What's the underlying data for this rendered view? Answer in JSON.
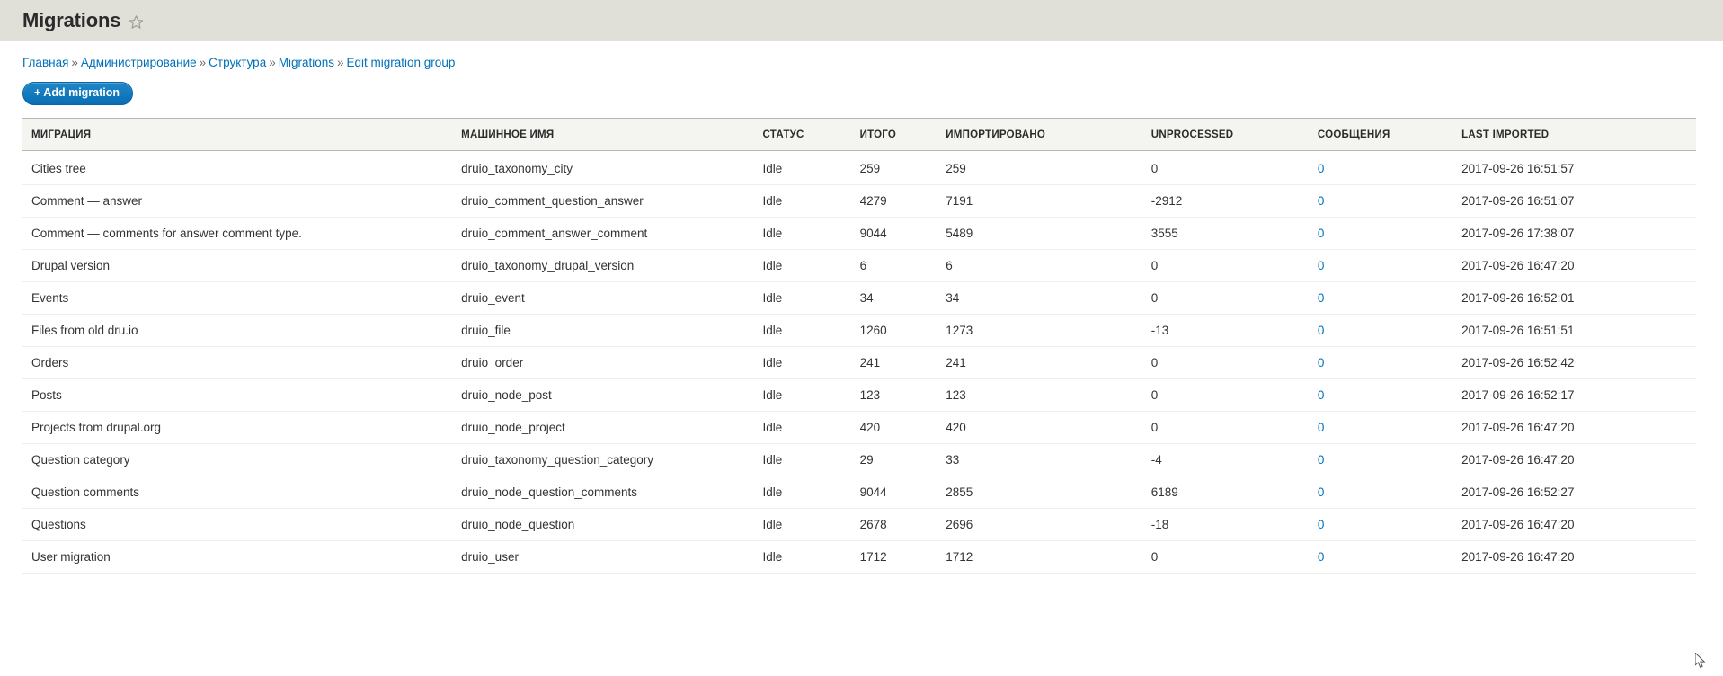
{
  "header": {
    "title": "Migrations",
    "star_icon": "star-outline-icon"
  },
  "breadcrumb": {
    "separator": "»",
    "items": [
      {
        "label": "Главная",
        "link": true
      },
      {
        "label": "Администрирование",
        "link": true
      },
      {
        "label": "Структура",
        "link": true
      },
      {
        "label": "Migrations",
        "link": true
      },
      {
        "label": "Edit migration group",
        "link": true
      }
    ]
  },
  "actions": {
    "add_migration_label": "+ Add migration"
  },
  "colors": {
    "header_band": "#e0e0d8",
    "link": "#0071b8",
    "button": "#1078be",
    "table_head_bg": "#f4f4f0",
    "row_border": "#eeeeea"
  },
  "table": {
    "columns": [
      "МИГРАЦИЯ",
      "МАШИННОЕ ИМЯ",
      "СТАТУС",
      "ИТОГО",
      "ИМПОРТИРОВАНО",
      "UNPROCESSED",
      "СООБЩЕНИЯ",
      "LAST IMPORTED"
    ],
    "rows": [
      {
        "name": "Cities tree",
        "machine_name": "druio_taxonomy_city",
        "status": "Idle",
        "total": "259",
        "imported": "259",
        "unprocessed": "0",
        "messages": "0",
        "last_imported": "2017-09-26 16:51:57"
      },
      {
        "name": "Comment — answer",
        "machine_name": "druio_comment_question_answer",
        "status": "Idle",
        "total": "4279",
        "imported": "7191",
        "unprocessed": "-2912",
        "messages": "0",
        "last_imported": "2017-09-26 16:51:07"
      },
      {
        "name": "Comment — comments for answer comment type.",
        "machine_name": "druio_comment_answer_comment",
        "status": "Idle",
        "total": "9044",
        "imported": "5489",
        "unprocessed": "3555",
        "messages": "0",
        "last_imported": "2017-09-26 17:38:07"
      },
      {
        "name": "Drupal version",
        "machine_name": "druio_taxonomy_drupal_version",
        "status": "Idle",
        "total": "6",
        "imported": "6",
        "unprocessed": "0",
        "messages": "0",
        "last_imported": "2017-09-26 16:47:20"
      },
      {
        "name": "Events",
        "machine_name": "druio_event",
        "status": "Idle",
        "total": "34",
        "imported": "34",
        "unprocessed": "0",
        "messages": "0",
        "last_imported": "2017-09-26 16:52:01"
      },
      {
        "name": "Files from old dru.io",
        "machine_name": "druio_file",
        "status": "Idle",
        "total": "1260",
        "imported": "1273",
        "unprocessed": "-13",
        "messages": "0",
        "last_imported": "2017-09-26 16:51:51"
      },
      {
        "name": "Orders",
        "machine_name": "druio_order",
        "status": "Idle",
        "total": "241",
        "imported": "241",
        "unprocessed": "0",
        "messages": "0",
        "last_imported": "2017-09-26 16:52:42"
      },
      {
        "name": "Posts",
        "machine_name": "druio_node_post",
        "status": "Idle",
        "total": "123",
        "imported": "123",
        "unprocessed": "0",
        "messages": "0",
        "last_imported": "2017-09-26 16:52:17"
      },
      {
        "name": "Projects from drupal.org",
        "machine_name": "druio_node_project",
        "status": "Idle",
        "total": "420",
        "imported": "420",
        "unprocessed": "0",
        "messages": "0",
        "last_imported": "2017-09-26 16:47:20"
      },
      {
        "name": "Question category",
        "machine_name": "druio_taxonomy_question_category",
        "status": "Idle",
        "total": "29",
        "imported": "33",
        "unprocessed": "-4",
        "messages": "0",
        "last_imported": "2017-09-26 16:47:20"
      },
      {
        "name": "Question comments",
        "machine_name": "druio_node_question_comments",
        "status": "Idle",
        "total": "9044",
        "imported": "2855",
        "unprocessed": "6189",
        "messages": "0",
        "last_imported": "2017-09-26 16:52:27"
      },
      {
        "name": "Questions",
        "machine_name": "druio_node_question",
        "status": "Idle",
        "total": "2678",
        "imported": "2696",
        "unprocessed": "-18",
        "messages": "0",
        "last_imported": "2017-09-26 16:47:20"
      },
      {
        "name": "User migration",
        "machine_name": "druio_user",
        "status": "Idle",
        "total": "1712",
        "imported": "1712",
        "unprocessed": "0",
        "messages": "0",
        "last_imported": "2017-09-26 16:47:20"
      }
    ]
  }
}
